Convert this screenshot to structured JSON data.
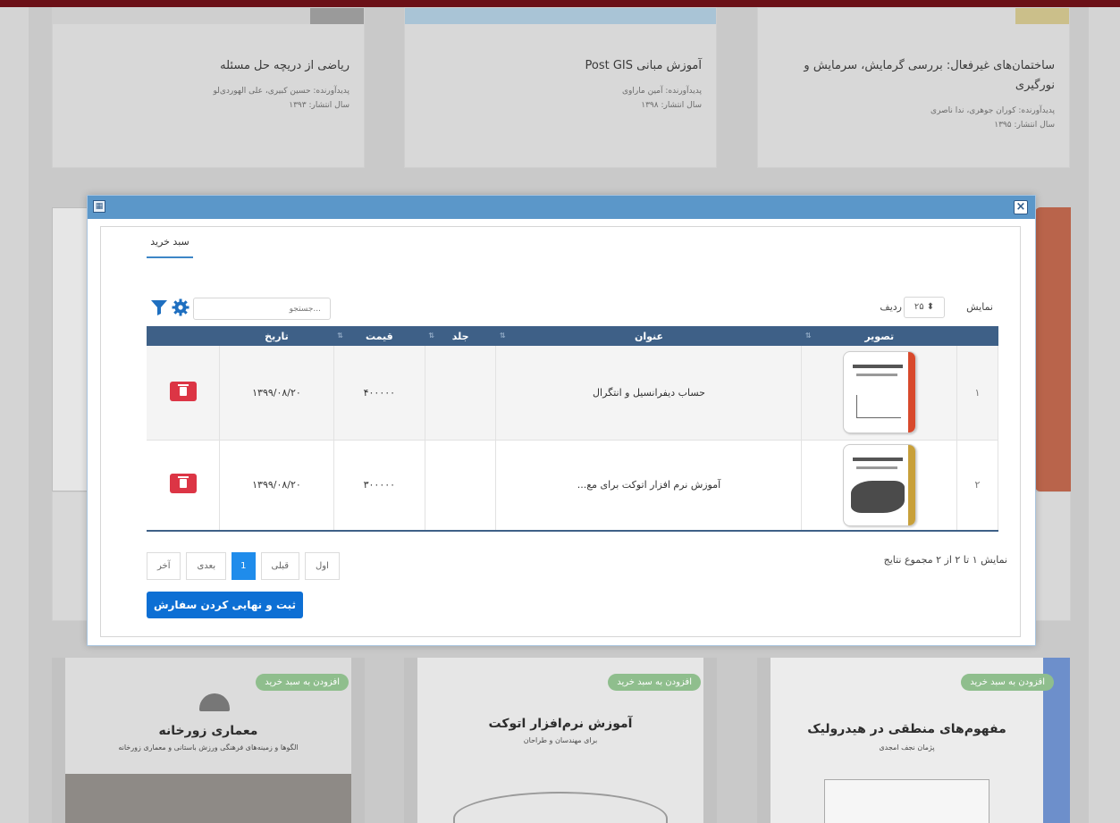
{
  "background_cards": [
    {
      "title": "ریاضی از دریچه حل مسئله",
      "author": "پدیدآورنده: حسین کبیری، علی الهوردی‌لو",
      "year": "سال انتشار: ۱۳۹۳"
    },
    {
      "title": "آموزش مبانی Post GIS",
      "author": "پدیدآورنده: آمین ماراوی",
      "year": "سال انتشار: ۱۳۹۸"
    },
    {
      "title": "ساختمان‌های غیرفعال: بررسی گرمایش، سرمایش و نورگیری",
      "author": "پدیدآورنده: کوران جوهری، ندا ناصری",
      "year": "سال انتشار: ۱۳۹۵"
    }
  ],
  "bottom_books": [
    {
      "badge": "افزودن به سبد خرید",
      "title": "معماری زورخانه",
      "subtitle": "الگوها و زمینه‌های فرهنگی ورزش باستانی و معماری زورخانه"
    },
    {
      "badge": "افزودن به سبد خرید",
      "title": "آموزش نرم‌افزار اتوکت",
      "subtitle": "برای مهندسان و طراحان"
    },
    {
      "badge": "افزودن به سبد خرید",
      "title": "مفهوم‌های منطقی در هیدرولیک",
      "subtitle": "پژمان نجف امجدی"
    }
  ],
  "dialog": {
    "close_icon": "×",
    "tab_label": "سبد خرید",
    "show_label": "نمایش",
    "page_size": "۲۵ ⬍",
    "rows_label": "ردیف",
    "search_placeholder": "جستجو...",
    "columns": {
      "image": "تصویر",
      "title": "عنوان",
      "volume": "جلد",
      "price": "قیمت",
      "date": "تاریخ"
    },
    "rows": [
      {
        "num": "۱",
        "title": "حساب دیفرانسیل و انتگرال",
        "volume": "",
        "price": "۴۰۰۰۰۰",
        "date": "۱۳۹۹/۰۸/۲۰"
      },
      {
        "num": "۲",
        "title": "آموزش نرم افزار اتوکت برای مع...",
        "volume": "",
        "price": "۳۰۰۰۰۰",
        "date": "۱۳۹۹/۰۸/۲۰"
      }
    ],
    "summary": "نمایش ۱ تا ۲ از ۲ مجموع نتایج",
    "pager": {
      "first": "اول",
      "prev": "قبلی",
      "current": "1",
      "next": "بعدی",
      "last": "آخر"
    },
    "submit_label": "ثبت و نهایی کردن سفارش"
  },
  "colors": {
    "header_bar": "#6b1017",
    "dialog_title": "#5b97c9",
    "table_header": "#3e6087",
    "delete": "#dc3545",
    "primary": "#0d6fd4"
  }
}
